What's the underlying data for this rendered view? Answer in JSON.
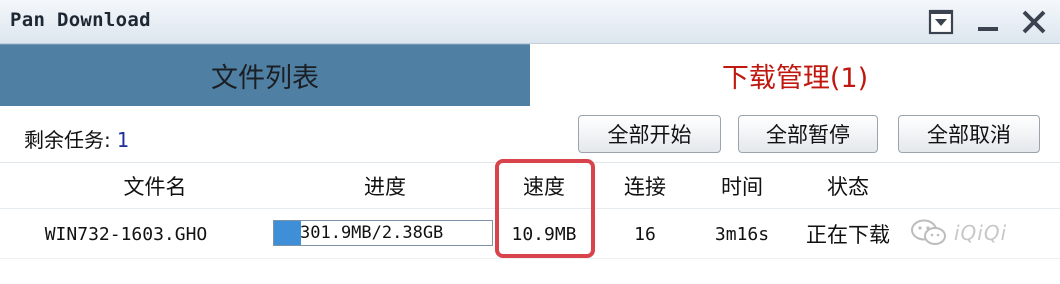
{
  "window": {
    "title": "Pan Download"
  },
  "tabs": [
    {
      "label": "文件列表"
    },
    {
      "label": "下载管理(1)"
    }
  ],
  "toolbar": {
    "remaining_label": "剩余任务:",
    "remaining_count": "1",
    "start_all": "全部开始",
    "pause_all": "全部暂停",
    "cancel_all": "全部取消"
  },
  "table": {
    "columns": [
      "文件名",
      "进度",
      "速度",
      "连接",
      "时间",
      "状态"
    ],
    "rows": [
      {
        "filename": "WIN732-1603.GHO",
        "progress_text": "301.9MB/2.38GB",
        "progress_fraction": 0.124,
        "speed": "10.9MB",
        "connections": "16",
        "time": "3m16s",
        "status": "正在下载"
      }
    ]
  },
  "watermark": {
    "text": "iQiQi"
  },
  "colors": {
    "tab_active_text": "#c0170f",
    "tab_inactive_bg": "#4f7fa3",
    "progress_fill": "#3f8fd8",
    "highlight": "#d9434c"
  },
  "icons": {
    "dropdown": "dropdown-box-icon",
    "minimize": "minimize-icon",
    "close": "close-icon",
    "watermark": "wechat-icon"
  }
}
